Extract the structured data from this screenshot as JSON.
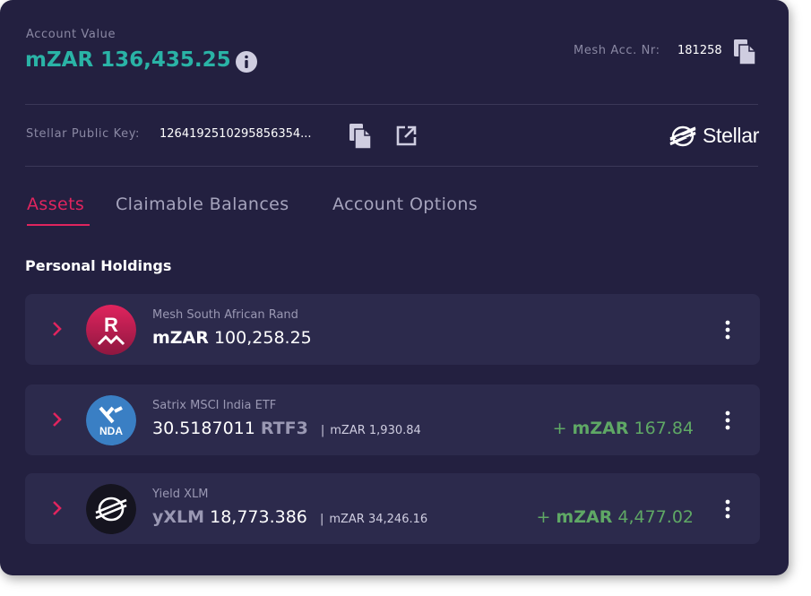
{
  "account": {
    "value_label": "Account Value",
    "value": "mZAR 136,435.25",
    "mesh_label": "Mesh Acc. Nr:",
    "mesh_number": "181258"
  },
  "stellar": {
    "key_label": "Stellar Public Key:",
    "key_value": "1264192510295856354...",
    "brand": "Stellar"
  },
  "tabs": [
    {
      "label": "Assets",
      "active": true
    },
    {
      "label": "Claimable Balances",
      "active": false
    },
    {
      "label": "Account Options",
      "active": false
    }
  ],
  "section_title": "Personal Holdings",
  "assets": [
    {
      "name": "Mesh South African Rand",
      "code": "mZAR",
      "amount": "100,258.25",
      "logo_icon": "mesh-rand-logo",
      "logo_letter": "R"
    },
    {
      "name": "Satrix MSCI India ETF",
      "amount": "30.5187011",
      "code": "RTF3",
      "separator": "|",
      "sub_value": "mZAR 1,930.84",
      "gain_prefix": "+",
      "gain_code": "mZAR",
      "gain_amount": "167.84",
      "logo_icon": "satrix-nda-logo",
      "logo_text": "NDA"
    },
    {
      "name": "Yield XLM",
      "code": "yXLM",
      "amount": "18,773.386",
      "separator": "|",
      "sub_value": "mZAR 34,246.16",
      "gain_prefix": "+",
      "gain_code": "mZAR",
      "gain_amount": "4,477.02",
      "logo_icon": "stellar-logo"
    }
  ],
  "colors": {
    "background": "#232040",
    "row": "#2c2a4c",
    "accent_teal": "#2ab3a6",
    "accent_pink": "#e0245e",
    "gain_green": "#5fa865"
  }
}
